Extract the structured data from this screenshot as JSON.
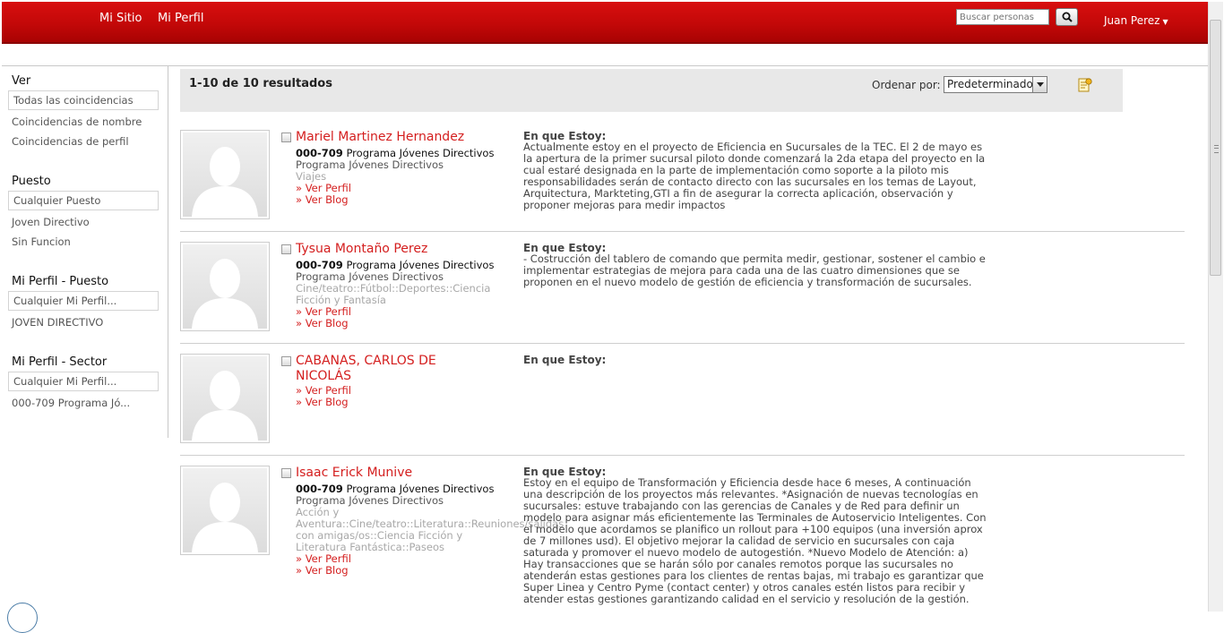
{
  "topbar": {
    "nav": [
      "Mi Sitio",
      "Mi Perfil"
    ],
    "search_placeholder": "Buscar personas",
    "user_name": "Juan Perez"
  },
  "filters": {
    "ver": {
      "title": "Ver",
      "selected": "Todas las coincidencias",
      "options": [
        "Coincidencias de nombre",
        "Coincidencias de perfil"
      ]
    },
    "puesto": {
      "title": "Puesto",
      "selected": "Cualquier Puesto",
      "options": [
        "Joven Directivo",
        "Sin Funcion"
      ]
    },
    "perfil_puesto": {
      "title": "Mi Perfil - Puesto",
      "selected": "Cualquier Mi Perfil...",
      "options": [
        "JOVEN DIRECTIVO"
      ]
    },
    "perfil_sector": {
      "title": "Mi Perfil - Sector",
      "selected": "Cualquier Mi Perfil...",
      "options": [
        "000-709 Programa Jó..."
      ]
    }
  },
  "results_header": {
    "count": "1-10 de 10 resultados",
    "sort_label": "Ordenar por:",
    "sort_value": "Predeterminado"
  },
  "results": [
    {
      "name": "Mariel Martinez Hernandez",
      "dept_code": "000-709",
      "dept_name": "Programa Jóvenes Directivos",
      "line2": "Programa Jóvenes Directivos",
      "interests": "Viajes",
      "link_profile": "» Ver Perfil",
      "link_blog": "» Ver Blog",
      "status_title": "En que Estoy:",
      "status_text": "Actualmente estoy en el proyecto de Eficiencia en Sucursales de la TEC. El 2 de mayo es la apertura de la primer sucursal piloto donde comenzará la 2da etapa del proyecto en la cual estaré designada en la parte de implementación como soporte a la piloto mis responsabilidades serán de contacto directo con las sucursales en los temas de Layout, Arquitectura, Markteting,GTI a fin de asegurar la correcta aplicación, observación y proponer mejoras para medir impactos"
    },
    {
      "name": "Tysua Montaño Perez",
      "dept_code": "000-709",
      "dept_name": "Programa Jóvenes Directivos",
      "line2": "Programa Jóvenes Directivos",
      "interests": "Cine/teatro::Fútbol::Deportes::Ciencia Ficción y Fantasía",
      "link_profile": "» Ver Perfil",
      "link_blog": "» Ver Blog",
      "status_title": "En que Estoy:",
      "status_text": "- Costrucción del tablero de comando que permita medir, gestionar, sostener el cambio e implementar estrategias de mejora para cada una de las cuatro dimensiones que se proponen en el nuevo modelo de gestión de eficiencia y transformación de sucursales."
    },
    {
      "name": "CABANAS, CARLOS DE NICOLÁS",
      "link_profile": "» Ver Perfil",
      "link_blog": "» Ver Blog",
      "status_title": "En que Estoy:"
    },
    {
      "name": "Isaac Erick Munive",
      "dept_code": "000-709",
      "dept_name": "Programa Jóvenes Directivos",
      "line2": "Programa Jóvenes Directivos",
      "interests": "Acción y Aventura::Cine/teatro::Literatura::Reuniones/salidas con amigas/os::Ciencia Ficción y Literatura Fantástica::Paseos",
      "link_profile": "» Ver Perfil",
      "link_blog": "» Ver Blog",
      "status_title": "En que Estoy:",
      "status_text": "Estoy en el equipo de Transformación y Eficiencia desde hace 6 meses, A continuación una descripción de los proyectos más relevantes. *Asignación de nuevas tecnologías en sucursales: estuve trabajando con las gerencias de Canales y de Red para definir un modelo para asignar más eficientemente las Terminales de Autoservicio Inteligentes. Con el modelo que acordamos se planifico un rollout para +100 equipos (una inversión aprox de 7 millones usd). El objetivo mejorar la calidad de servicio en sucursales con caja saturada y promover el nuevo modelo de autogestión. *Nuevo Modelo de Atención: a) Hay transacciones que se harán sólo por canales remotos porque las sucursales no atenderán estas gestiones para los clientes de rentas bajas, mi trabajo es garantizar que Super Linea y Centro Pyme (contact center) y otros canales estén listos para recibir y atender estas gestiones garantizando calidad en el servicio y resolución de la gestión."
    }
  ]
}
